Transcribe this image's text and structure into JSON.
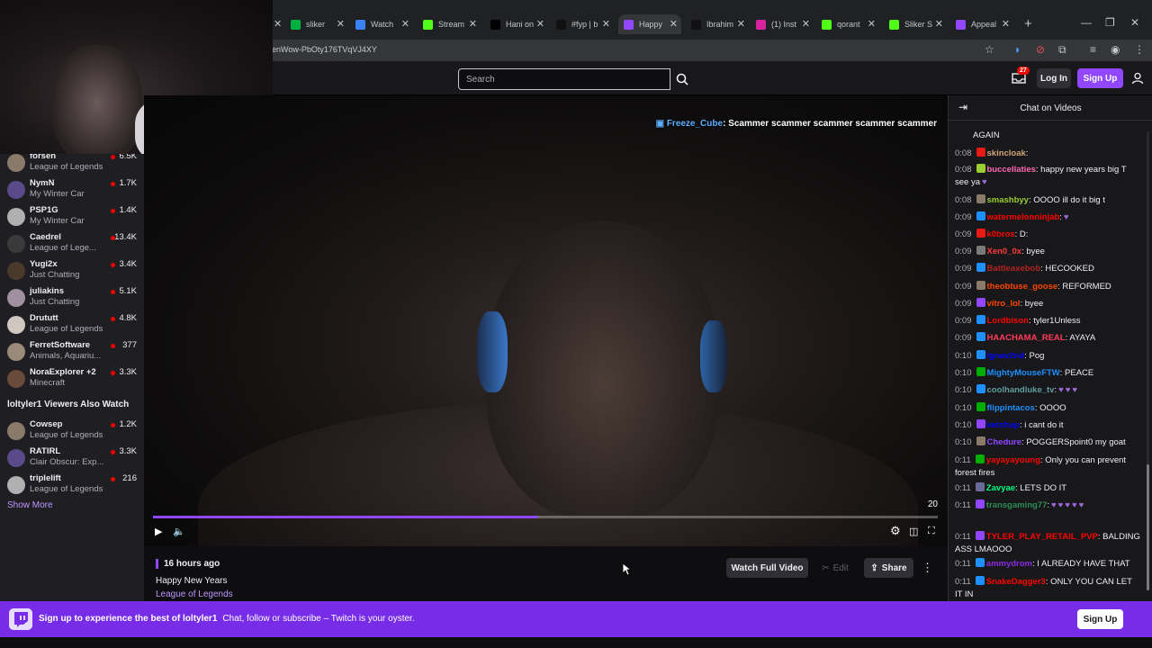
{
  "browser": {
    "tabs": [
      {
        "label": "sliker",
        "color": "#00b140",
        "icon": "sliker-icon"
      },
      {
        "label": "Watch",
        "color": "#3b82f6",
        "icon": "watch-icon"
      },
      {
        "label": "Stream",
        "color": "#53fc18",
        "icon": "kick-icon"
      },
      {
        "label": "Hani on",
        "color": "#000000",
        "icon": "x-icon"
      },
      {
        "label": "#fyp | b",
        "color": "#111111",
        "icon": "tiktok-icon"
      },
      {
        "label": "Happy",
        "color": "#9146ff",
        "icon": "twitch-icon",
        "active": true
      },
      {
        "label": "Ibrahim",
        "color": "#111111",
        "icon": "tiktok-icon"
      },
      {
        "label": "(1) Inst",
        "color": "#d6249f",
        "icon": "instagram-icon"
      },
      {
        "label": "qorant",
        "color": "#53fc18",
        "icon": "kick-icon"
      },
      {
        "label": "Sliker S",
        "color": "#53fc18",
        "icon": "kick-icon"
      },
      {
        "label": "Appeal",
        "color": "#9146ff",
        "icon": "twitch-icon"
      }
    ],
    "url": "enWow-PbOty176TVqVJ4XY"
  },
  "topnav": {
    "search_placeholder": "Search",
    "inbox_count": "27",
    "login_label": "Log In",
    "signup_label": "Sign Up"
  },
  "sidebar": {
    "channels": [
      {
        "name": "forsen",
        "game": "League of Legends",
        "viewers": "6.5K"
      },
      {
        "name": "NymN",
        "game": "My Winter Car",
        "viewers": "1.7K"
      },
      {
        "name": "PSP1G",
        "game": "My Winter Car",
        "viewers": "1.4K"
      },
      {
        "name": "Caedrel",
        "game": "League of Lege...",
        "viewers": "13.4K"
      },
      {
        "name": "Yugi2x",
        "game": "Just Chatting",
        "viewers": "3.4K"
      },
      {
        "name": "juliakins",
        "game": "Just Chatting",
        "viewers": "5.1K"
      },
      {
        "name": "Drututt",
        "game": "League of Legends",
        "viewers": "4.8K"
      },
      {
        "name": "FerretSoftware",
        "game": "Animals, Aquariu...",
        "viewers": "377"
      },
      {
        "name": "NoraExplorer +2",
        "game": "Minecraft",
        "viewers": "3.3K"
      }
    ],
    "also_watch_heading": "loltyler1 Viewers Also Watch",
    "also_watch": [
      {
        "name": "Cowsep",
        "game": "League of Legends",
        "viewers": "1.2K"
      },
      {
        "name": "RATIRL",
        "game": "Clair Obscur: Exp...",
        "viewers": "3.3K"
      },
      {
        "name": "triplelift",
        "game": "League of Legends",
        "viewers": "216"
      }
    ],
    "show_more": "Show More"
  },
  "player": {
    "overlay_user": "Freeze_Cube",
    "overlay_text": ": Scammer scammer scammer scammer scammer",
    "time_label": "20",
    "progress": 0.49
  },
  "video_info": {
    "ago": "16 hours ago",
    "title": "Happy New Years",
    "game": "League of Legends",
    "watch_full": "Watch Full Video",
    "edit": "Edit",
    "share": "Share"
  },
  "chat": {
    "title": "Chat on Videos",
    "messages": [
      {
        "ts": "",
        "user": "",
        "color": "#efeff1",
        "text": "AGAIN",
        "hearts": 0
      },
      {
        "ts": "0:08",
        "user": "skincloak",
        "color": "#d2a679",
        "text": ":",
        "hearts": 0
      },
      {
        "ts": "0:08",
        "user": "buccellaties",
        "color": "#ff69b4",
        "text": ": happy new years big T see ya",
        "hearts": 1
      },
      {
        "ts": "0:08",
        "user": "smashbyy",
        "color": "#9acd32",
        "text": ": OOOO ill do it big t",
        "hearts": 0
      },
      {
        "ts": "0:09",
        "user": "watermelonninjab",
        "color": "#ff0000",
        "text": ":",
        "hearts": 1
      },
      {
        "ts": "0:09",
        "user": "k0bros",
        "color": "#ff0000",
        "text": ": D:",
        "hearts": 0
      },
      {
        "ts": "0:09",
        "user": "Xen0_0x",
        "color": "#ff3b3b",
        "text": ": byee",
        "hearts": 0
      },
      {
        "ts": "0:09",
        "user": "Battleaxebob",
        "color": "#b22222",
        "text": ": HECOOKED",
        "hearts": 0
      },
      {
        "ts": "0:09",
        "user": "theobtuse_goose",
        "color": "#ff4500",
        "text": ": REFORMED",
        "hearts": 0
      },
      {
        "ts": "0:09",
        "user": "vitro_lol",
        "color": "#ff4500",
        "text": ": byee",
        "hearts": 0
      },
      {
        "ts": "0:09",
        "user": "Lordbison",
        "color": "#ff0000",
        "text": ": tyler1Unless",
        "hearts": 0
      },
      {
        "ts": "0:09",
        "user": "HAACHAMA_REAL",
        "color": "#ff3b5c",
        "text": ": AYAYA",
        "hearts": 0
      },
      {
        "ts": "0:10",
        "user": "Ignav2nd",
        "color": "#0000ff",
        "text": ": Pog",
        "hearts": 0
      },
      {
        "ts": "0:10",
        "user": "MightyMouseFTW",
        "color": "#1e90ff",
        "text": ": PEACE",
        "hearts": 0
      },
      {
        "ts": "0:10",
        "user": "coolhandluke_tv",
        "color": "#5f9ea0",
        "text": ":",
        "hearts": 3
      },
      {
        "ts": "0:10",
        "user": "flippintacos",
        "color": "#1e90ff",
        "text": ": OOOO",
        "hearts": 0
      },
      {
        "ts": "0:10",
        "user": "ketchup",
        "color": "#0000ff",
        "text": ": i cant do it",
        "hearts": 0
      },
      {
        "ts": "0:10",
        "user": "Chedure",
        "color": "#9146ff",
        "text": ": POGGERSpoint0 my goat",
        "hearts": 0
      },
      {
        "ts": "0:11",
        "user": "yayayayoung",
        "color": "#ff0000",
        "text": ": Only you can prevent forest fires",
        "hearts": 0
      },
      {
        "ts": "0:11",
        "user": "Zavyae",
        "color": "#00ff7f",
        "text": ": LETS DO IT",
        "hearts": 0
      },
      {
        "ts": "0:11",
        "user": "transgaming77",
        "color": "#2e8b57",
        "text": ":",
        "hearts": 5
      },
      {
        "ts": "0:11",
        "user": "TYLER_PLAY_RETAIL_PVP",
        "color": "#ff0000",
        "text": ": BALDING ASS LMAOOO",
        "hearts": 0
      },
      {
        "ts": "0:11",
        "user": "ammydrom",
        "color": "#8a2be2",
        "text": ": I ALREADY HAVE THAT",
        "hearts": 0
      },
      {
        "ts": "0:11",
        "user": "SnakeDagger3",
        "color": "#ff0000",
        "text": ": ONLY YOU CAN LET IT IN",
        "hearts": 0
      }
    ]
  },
  "banner": {
    "headline": "Sign up to experience the best of loltyler1",
    "subtext": "Chat, follow or subscribe – Twitch is your oyster.",
    "signup_label": "Sign Up"
  },
  "colors": {
    "accent": "#9147ff",
    "live": "#eb0400",
    "banner": "#772ce8"
  }
}
